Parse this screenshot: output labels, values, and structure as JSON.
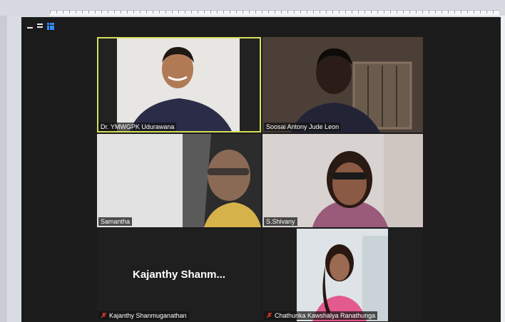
{
  "app": "Zoom meeting",
  "view_controls": [
    {
      "name": "minimize-icon"
    },
    {
      "name": "speaker-view-icon"
    },
    {
      "name": "gallery-view-icon",
      "color": "#2f8cff"
    }
  ],
  "participants": [
    {
      "name": "Dr. YMWGPK Udurawana",
      "active_speaker": true,
      "muted": false,
      "video": true
    },
    {
      "name": "Soosai Antony Jude Leon",
      "muted": false,
      "video": true
    },
    {
      "name": "Samantha",
      "muted": false,
      "video": true
    },
    {
      "name": "S.Shivany",
      "muted": false,
      "video": true
    },
    {
      "name": "Kajanthy Shanmuganathan",
      "display_name_truncated": "Kajanthy  Shanm...",
      "muted": true,
      "video": false
    },
    {
      "name": "Chathurika Kawshalya Ranathunga",
      "muted": true,
      "video": true
    }
  ],
  "colors": {
    "active_border": "#d3e05a",
    "muted_icon": "#e0342b",
    "window_bg": "#1b1b1b"
  }
}
